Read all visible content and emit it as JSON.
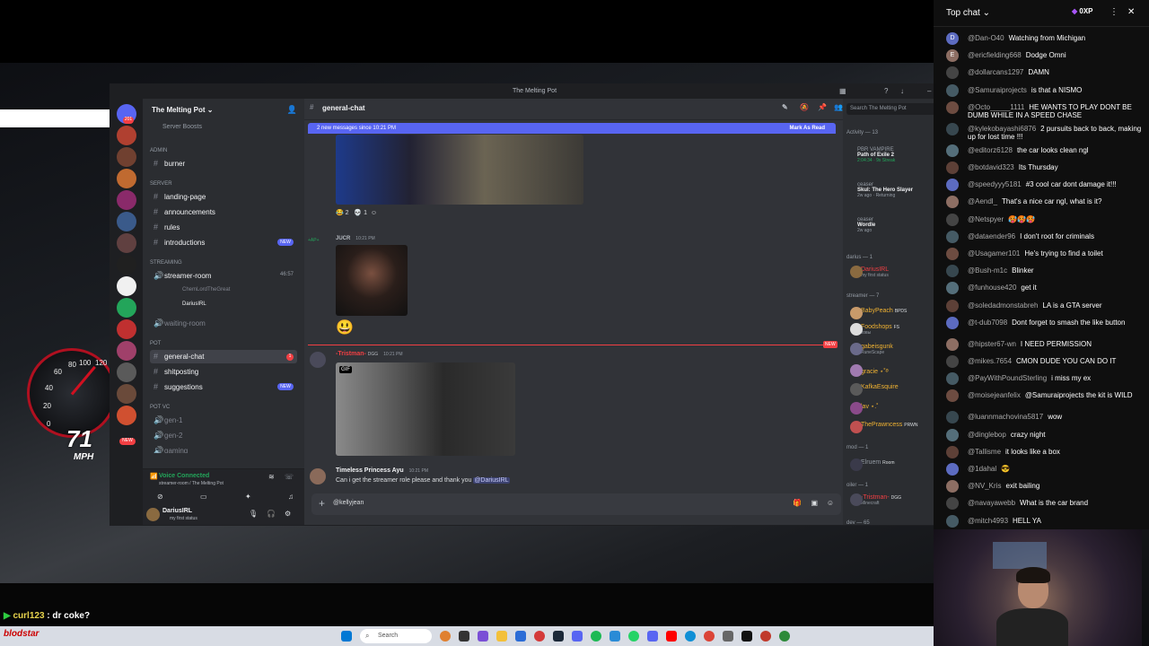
{
  "stream": {
    "speed_value": "71",
    "speed_unit": "MPH",
    "speed_ticks": [
      "60",
      "80",
      "100",
      "120",
      "40",
      "20",
      "0"
    ],
    "overlay_user": "curl123",
    "overlay_text": ": dr coke?",
    "taskbar_label": "blodstar",
    "taskbar_search": "Search"
  },
  "discord": {
    "window_title": "The Melting Pot",
    "guild_name": "The Melting Pot",
    "server_boosts": "Server Boosts",
    "categories": {
      "admin": "ADMIN",
      "server": "server",
      "streaming": "streaming",
      "pot": "pot",
      "pot_vc": "pot vc"
    },
    "channels": {
      "burner": "burner",
      "landing": "landing-page",
      "announcements": "announcements",
      "rules": "rules",
      "introductions": "introductions",
      "streamer_room": "streamer-room",
      "streamer_room_count": "46:57",
      "voice_user1": "ChemLordTheGreat",
      "voice_user2": "DariusIRL",
      "waiting_room": "waiting-room",
      "general_chat": "general-chat",
      "shitposting": "shitposting",
      "suggestions": "suggestions",
      "gen1": "gen-1",
      "gen2": "gen-2",
      "gaming": "gaming"
    },
    "new_label": "NEW",
    "voice_connected": "Voice Connected",
    "voice_location": "streamer-room / The Melting Pot",
    "user_name": "DariusIRL",
    "user_status": "my first status",
    "server_badges": [
      "201",
      "21",
      "2",
      "2",
      "2",
      "21",
      "15",
      "2",
      "33",
      "2",
      "12"
    ],
    "general_unread": "1",
    "channel_title": "general-chat",
    "new_messages_banner": "2 new messages since 10:21 PM",
    "mark_as_read": "Mark As Read",
    "reactions": [
      {
        "emoji": "😂",
        "count": "2"
      },
      {
        "emoji": "💀",
        "count": "1"
      }
    ],
    "msg2_user": "JUCR",
    "msg2_time": "10:21 PM",
    "msg2_side": "+AP+",
    "msg3_user": "-Tristman-",
    "msg3_tag": "DGG",
    "msg3_time": "10:21 PM",
    "gif_label": "GIF",
    "new_divider": "NEW",
    "msg4_user": "Timeless Princess Ayu",
    "msg4_time": "10:21 PM",
    "msg4_text": "Can i get the streamer role please and thank you",
    "msg4_mention": "@DariusIRL",
    "composer_text": "@kellyjean",
    "search_placeholder": "Search The Melting Pot",
    "activity_header": "Activity — 13",
    "activities": [
      {
        "user": "PBR VAMPIRE",
        "game": "Path of Exile 2",
        "meta": "2:04:34 · 9x Streak"
      },
      {
        "user": "ceaser",
        "game": "Skul: The Hero Slayer",
        "meta": "2w ago · Returning"
      },
      {
        "user": "ceaser",
        "game": "Wordle",
        "meta": "2w ago"
      }
    ],
    "member_groups": {
      "darius": "darius — 1",
      "streamer": "streamer — 7",
      "mod": "mod — 1",
      "oiler": "oiler — 1",
      "dev": "dev — 65"
    },
    "members": {
      "darius": {
        "name": "DariusIRL",
        "sub": "my first status"
      },
      "streamers": [
        {
          "name": "BabyPeach",
          "tag": "BPDS",
          "sub": ""
        },
        {
          "name": "Foodshops",
          "tag": "FS",
          "sub": "ковы"
        },
        {
          "name": "gabeisgunk",
          "tag": "",
          "sub": "RuneScape"
        },
        {
          "name": "gracie ⋆˚࿔",
          "tag": "",
          "sub": ""
        },
        {
          "name": "KafkaEsquire",
          "tag": "",
          "sub": ""
        },
        {
          "name": "lav ⋆.˚",
          "tag": "",
          "sub": ""
        },
        {
          "name": "ThePrawncess",
          "tag": "PRWN",
          "sub": ""
        }
      ],
      "mod": {
        "name": "Elruem",
        "tag": "Room"
      },
      "oiler": {
        "name": "-Tristman-",
        "tag": "DGG",
        "sub": "Minecraft"
      }
    }
  },
  "livechat": {
    "header": "Top chat",
    "xp": "0XP",
    "messages": [
      {
        "av": "D",
        "user": "@Dan-O40",
        "text": "Watching from Michigan"
      },
      {
        "av": "E",
        "user": "@ericfielding668",
        "text": "Dodge Omni"
      },
      {
        "av": "",
        "user": "@dollarcans1297",
        "text": "DAMN"
      },
      {
        "av": "",
        "user": "@Samuraiprojects",
        "text": "is that a NISMO"
      },
      {
        "av": "",
        "user": "@Octo_____1111",
        "text": "HE WANTS TO PLAY DONT BE DUMB WHILE IN A SPEED CHASE"
      },
      {
        "av": "",
        "user": "@kylekobayashi6876",
        "text": "2 pursuits back to back, making up for lost time !!!"
      },
      {
        "av": "",
        "user": "@editorz6128",
        "text": "the car looks clean ngl"
      },
      {
        "av": "",
        "user": "@botdavid323",
        "text": "Its Thursday"
      },
      {
        "av": "",
        "user": "@speedyyy5181",
        "text": "#3 cool car dont damage it!!!"
      },
      {
        "av": "",
        "user": "@Aendl_",
        "text": "That's a nice car ngl, what is it?"
      },
      {
        "av": "",
        "user": "@Netspyer",
        "text": "🥵🥵🥵"
      },
      {
        "av": "",
        "user": "@dataender96",
        "text": "I don't root for criminals"
      },
      {
        "av": "",
        "user": "@Usagamer101",
        "text": "He's trying to find a toilet"
      },
      {
        "av": "",
        "user": "@Bush-m1c",
        "text": "Blinker"
      },
      {
        "av": "",
        "user": "@funhouse420",
        "text": "get it"
      },
      {
        "av": "",
        "user": "@soledadmonstabreh",
        "text": "LA is a GTA server"
      },
      {
        "av": "",
        "user": "@t-dub7098",
        "text": "Dont forget to smash the like button"
      },
      {
        "av": "",
        "user": "@hipster67-wn",
        "text": "I NEED PERMISSION"
      },
      {
        "av": "",
        "user": "@mikes.7654",
        "text": "CMON DUDE YOU CAN DO IT"
      },
      {
        "av": "",
        "user": "@PayWithPoundSterling",
        "text": "i miss my ex"
      },
      {
        "av": "",
        "user": "@moisejeanfelix",
        "text": "@Samuraiprojects the kit is WILD"
      },
      {
        "av": "",
        "user": "@luannmachovina5817",
        "text": "wow"
      },
      {
        "av": "",
        "user": "@dinglebop",
        "text": "crazy night"
      },
      {
        "av": "",
        "user": "@Tallisme",
        "text": "it looks like a box"
      },
      {
        "av": "",
        "user": "@1dahal",
        "text": "😎"
      },
      {
        "av": "",
        "user": "@NV_Kris",
        "text": "exit bailing"
      },
      {
        "av": "",
        "user": "@navayawebb",
        "text": "What is the car brand"
      },
      {
        "av": "",
        "user": "@mitch4993",
        "text": "HELL YA"
      }
    ]
  },
  "colors": {
    "blurple": "#5865f2",
    "discord_bg": "#313338",
    "red": "#f23f43",
    "green": "#23a55a",
    "streamer_gold": "#f0b232"
  }
}
